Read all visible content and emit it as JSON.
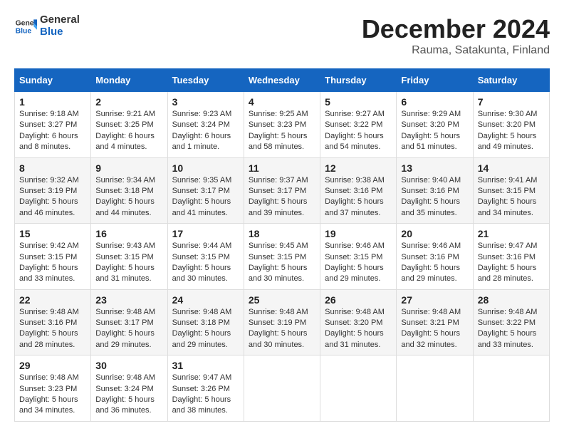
{
  "header": {
    "logo_general": "General",
    "logo_blue": "Blue",
    "month_title": "December 2024",
    "location": "Rauma, Satakunta, Finland"
  },
  "calendar": {
    "days_of_week": [
      "Sunday",
      "Monday",
      "Tuesday",
      "Wednesday",
      "Thursday",
      "Friday",
      "Saturday"
    ],
    "weeks": [
      [
        {
          "day": "1",
          "sunrise": "9:18 AM",
          "sunset": "3:27 PM",
          "daylight": "6 hours and 8 minutes."
        },
        {
          "day": "2",
          "sunrise": "9:21 AM",
          "sunset": "3:25 PM",
          "daylight": "6 hours and 4 minutes."
        },
        {
          "day": "3",
          "sunrise": "9:23 AM",
          "sunset": "3:24 PM",
          "daylight": "6 hours and 1 minute."
        },
        {
          "day": "4",
          "sunrise": "9:25 AM",
          "sunset": "3:23 PM",
          "daylight": "5 hours and 58 minutes."
        },
        {
          "day": "5",
          "sunrise": "9:27 AM",
          "sunset": "3:22 PM",
          "daylight": "5 hours and 54 minutes."
        },
        {
          "day": "6",
          "sunrise": "9:29 AM",
          "sunset": "3:20 PM",
          "daylight": "5 hours and 51 minutes."
        },
        {
          "day": "7",
          "sunrise": "9:30 AM",
          "sunset": "3:20 PM",
          "daylight": "5 hours and 49 minutes."
        }
      ],
      [
        {
          "day": "8",
          "sunrise": "9:32 AM",
          "sunset": "3:19 PM",
          "daylight": "5 hours and 46 minutes."
        },
        {
          "day": "9",
          "sunrise": "9:34 AM",
          "sunset": "3:18 PM",
          "daylight": "5 hours and 44 minutes."
        },
        {
          "day": "10",
          "sunrise": "9:35 AM",
          "sunset": "3:17 PM",
          "daylight": "5 hours and 41 minutes."
        },
        {
          "day": "11",
          "sunrise": "9:37 AM",
          "sunset": "3:17 PM",
          "daylight": "5 hours and 39 minutes."
        },
        {
          "day": "12",
          "sunrise": "9:38 AM",
          "sunset": "3:16 PM",
          "daylight": "5 hours and 37 minutes."
        },
        {
          "day": "13",
          "sunrise": "9:40 AM",
          "sunset": "3:16 PM",
          "daylight": "5 hours and 35 minutes."
        },
        {
          "day": "14",
          "sunrise": "9:41 AM",
          "sunset": "3:15 PM",
          "daylight": "5 hours and 34 minutes."
        }
      ],
      [
        {
          "day": "15",
          "sunrise": "9:42 AM",
          "sunset": "3:15 PM",
          "daylight": "5 hours and 33 minutes."
        },
        {
          "day": "16",
          "sunrise": "9:43 AM",
          "sunset": "3:15 PM",
          "daylight": "5 hours and 31 minutes."
        },
        {
          "day": "17",
          "sunrise": "9:44 AM",
          "sunset": "3:15 PM",
          "daylight": "5 hours and 30 minutes."
        },
        {
          "day": "18",
          "sunrise": "9:45 AM",
          "sunset": "3:15 PM",
          "daylight": "5 hours and 30 minutes."
        },
        {
          "day": "19",
          "sunrise": "9:46 AM",
          "sunset": "3:15 PM",
          "daylight": "5 hours and 29 minutes."
        },
        {
          "day": "20",
          "sunrise": "9:46 AM",
          "sunset": "3:16 PM",
          "daylight": "5 hours and 29 minutes."
        },
        {
          "day": "21",
          "sunrise": "9:47 AM",
          "sunset": "3:16 PM",
          "daylight": "5 hours and 28 minutes."
        }
      ],
      [
        {
          "day": "22",
          "sunrise": "9:48 AM",
          "sunset": "3:16 PM",
          "daylight": "5 hours and 28 minutes."
        },
        {
          "day": "23",
          "sunrise": "9:48 AM",
          "sunset": "3:17 PM",
          "daylight": "5 hours and 29 minutes."
        },
        {
          "day": "24",
          "sunrise": "9:48 AM",
          "sunset": "3:18 PM",
          "daylight": "5 hours and 29 minutes."
        },
        {
          "day": "25",
          "sunrise": "9:48 AM",
          "sunset": "3:19 PM",
          "daylight": "5 hours and 30 minutes."
        },
        {
          "day": "26",
          "sunrise": "9:48 AM",
          "sunset": "3:20 PM",
          "daylight": "5 hours and 31 minutes."
        },
        {
          "day": "27",
          "sunrise": "9:48 AM",
          "sunset": "3:21 PM",
          "daylight": "5 hours and 32 minutes."
        },
        {
          "day": "28",
          "sunrise": "9:48 AM",
          "sunset": "3:22 PM",
          "daylight": "5 hours and 33 minutes."
        }
      ],
      [
        {
          "day": "29",
          "sunrise": "9:48 AM",
          "sunset": "3:23 PM",
          "daylight": "5 hours and 34 minutes."
        },
        {
          "day": "30",
          "sunrise": "9:48 AM",
          "sunset": "3:24 PM",
          "daylight": "5 hours and 36 minutes."
        },
        {
          "day": "31",
          "sunrise": "9:47 AM",
          "sunset": "3:26 PM",
          "daylight": "5 hours and 38 minutes."
        },
        null,
        null,
        null,
        null
      ]
    ]
  }
}
